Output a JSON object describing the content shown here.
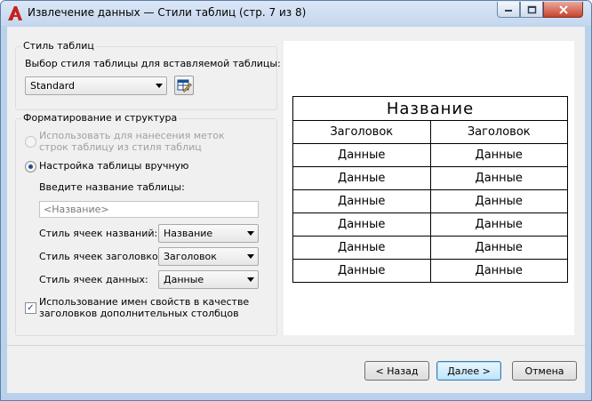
{
  "window": {
    "title": "Извлечение данных — Стили таблиц (стр. 7 из 8)"
  },
  "table_style": {
    "group_label": "Стиль таблиц",
    "select_label": "Выбор стиля таблицы для вставляемой таблицы:",
    "style_value": "Standard"
  },
  "formatting": {
    "group_label": "Форматирование и структура",
    "option_from_style": "Использовать для нанесения меток строк таблицу из стиля таблиц",
    "option_manual": "Настройка таблицы вручную",
    "table_name_label": "Введите название таблицы:",
    "table_name_value": "",
    "table_name_placeholder": "<Название>",
    "title_cell_label": "Стиль ячеек названий:",
    "title_cell_value": "Название",
    "header_cell_label": "Стиль ячеек заголовков:",
    "header_cell_value": "Заголовок",
    "data_cell_label": "Стиль ячеек данных:",
    "data_cell_value": "Данные",
    "use_props_label": "Использование имен свойств в качестве заголовков дополнительных столбцов",
    "use_props_checked": true
  },
  "preview": {
    "title": "Название",
    "headers": [
      "Заголовок",
      "Заголовок"
    ],
    "rows": [
      [
        "Данные",
        "Данные"
      ],
      [
        "Данные",
        "Данные"
      ],
      [
        "Данные",
        "Данные"
      ],
      [
        "Данные",
        "Данные"
      ],
      [
        "Данные",
        "Данные"
      ],
      [
        "Данные",
        "Данные"
      ]
    ]
  },
  "buttons": {
    "back": "< Назад",
    "next": "Далее >",
    "cancel": "Отмена"
  },
  "colors": {
    "accent_red": "#c8201e",
    "selection_blue": "#1b4f8f"
  }
}
